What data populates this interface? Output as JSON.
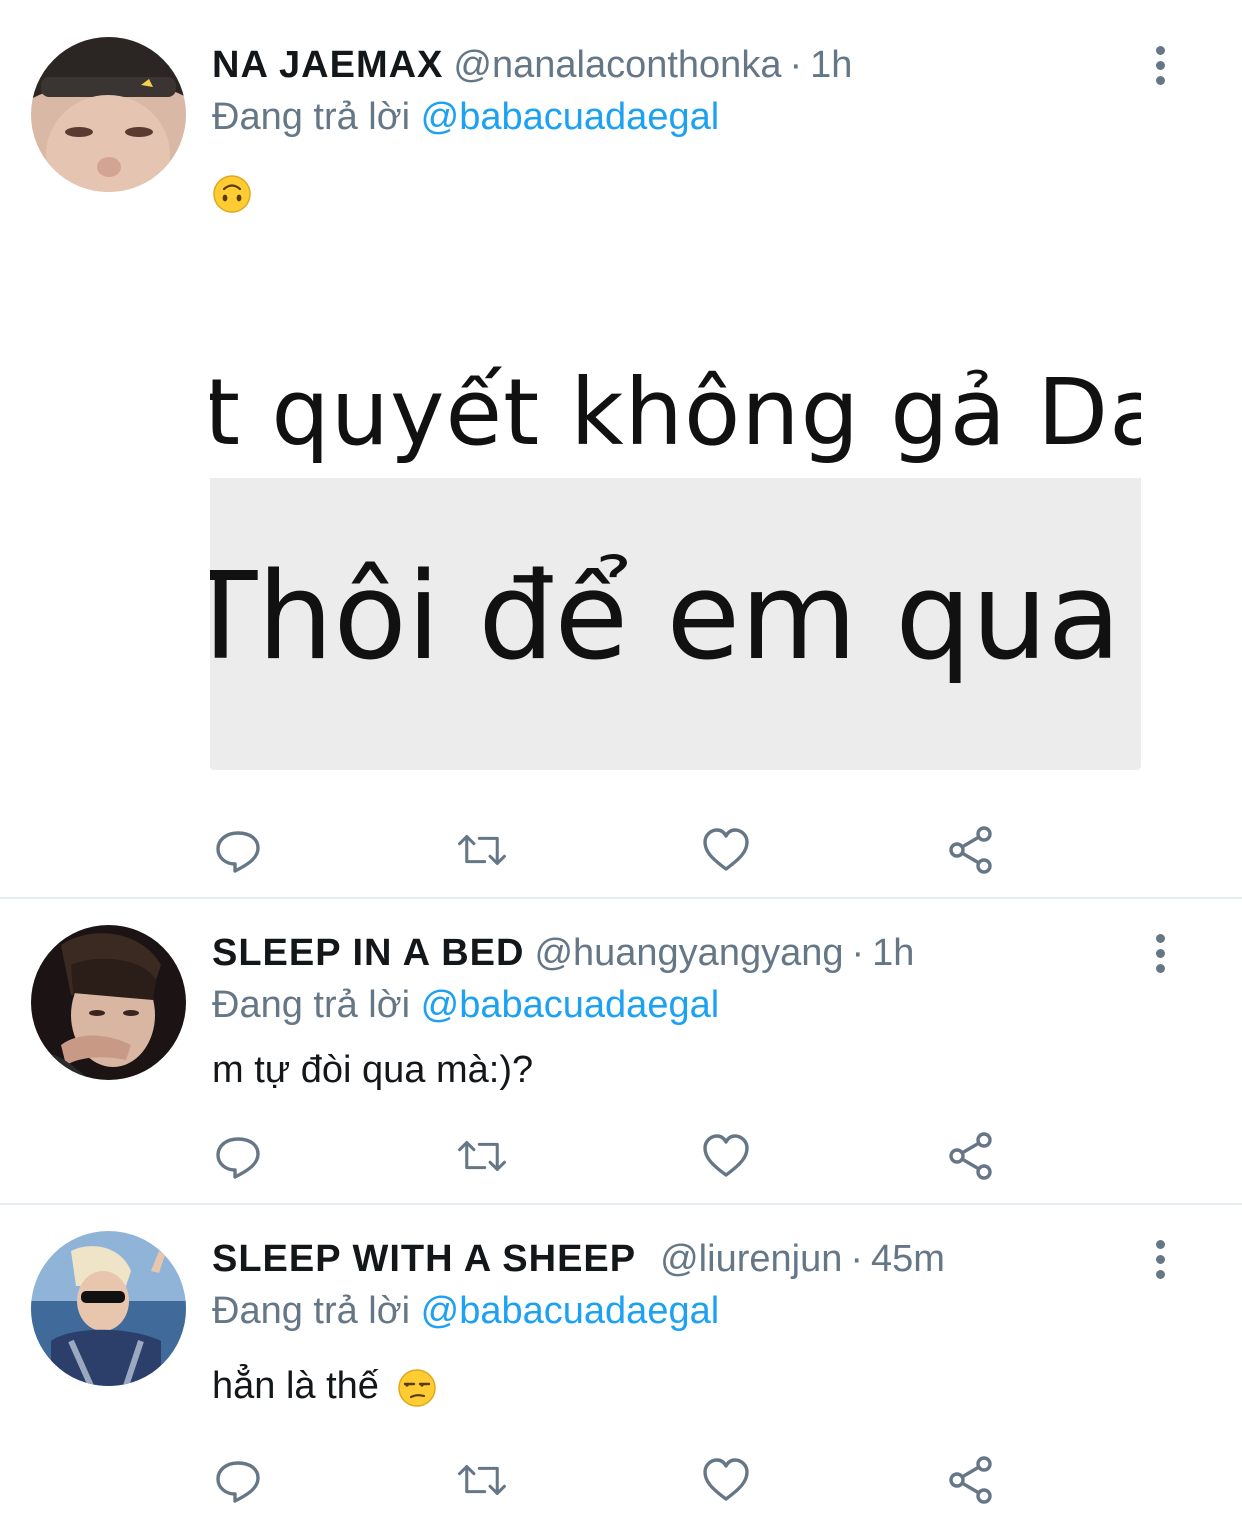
{
  "tweets": [
    {
      "name": "NA JAEMAX",
      "handle": "@nanalaconthonka",
      "time": "1h",
      "replying_prefix": "Đang trả lời",
      "replying_to": "@babacuadaegal",
      "text": "",
      "emoji": "upside-down-face",
      "media_lines": [
        "t quyết không gả Da",
        "Thôi để em qua :"
      ]
    },
    {
      "name": "SLEEP IN A BED",
      "handle": "@huangyangyang",
      "time": "1h",
      "replying_prefix": "Đang trả lời",
      "replying_to": "@babacuadaegal",
      "text": "m tự đòi qua mà:)?"
    },
    {
      "name": "SLEEP WITH A SHEEP",
      "handle": "@liurenjun",
      "time": "45m",
      "replying_prefix": "Đang trả lời",
      "replying_to": "@babacuadaegal",
      "text": "hẳn là thế",
      "emoji": "unamused-face"
    }
  ],
  "separator": "·",
  "icons": {
    "reply": "reply-icon",
    "retweet": "retweet-icon",
    "like": "heart-icon",
    "share": "share-icon",
    "more": "more-vertical-icon"
  },
  "colors": {
    "mention": "#1da1f2",
    "secondary_text": "#657786",
    "divider": "#e6ecf0"
  }
}
